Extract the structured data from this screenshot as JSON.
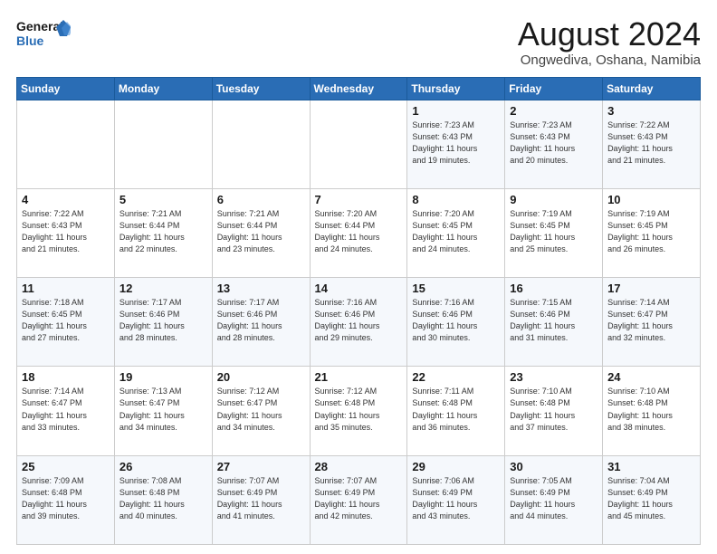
{
  "logo": {
    "line1": "General",
    "line2": "Blue"
  },
  "title": "August 2024",
  "subtitle": "Ongwediva, Oshana, Namibia",
  "weekdays": [
    "Sunday",
    "Monday",
    "Tuesday",
    "Wednesday",
    "Thursday",
    "Friday",
    "Saturday"
  ],
  "weeks": [
    [
      {
        "day": "",
        "info": ""
      },
      {
        "day": "",
        "info": ""
      },
      {
        "day": "",
        "info": ""
      },
      {
        "day": "",
        "info": ""
      },
      {
        "day": "1",
        "info": "Sunrise: 7:23 AM\nSunset: 6:43 PM\nDaylight: 11 hours\nand 19 minutes."
      },
      {
        "day": "2",
        "info": "Sunrise: 7:23 AM\nSunset: 6:43 PM\nDaylight: 11 hours\nand 20 minutes."
      },
      {
        "day": "3",
        "info": "Sunrise: 7:22 AM\nSunset: 6:43 PM\nDaylight: 11 hours\nand 21 minutes."
      }
    ],
    [
      {
        "day": "4",
        "info": "Sunrise: 7:22 AM\nSunset: 6:43 PM\nDaylight: 11 hours\nand 21 minutes."
      },
      {
        "day": "5",
        "info": "Sunrise: 7:21 AM\nSunset: 6:44 PM\nDaylight: 11 hours\nand 22 minutes."
      },
      {
        "day": "6",
        "info": "Sunrise: 7:21 AM\nSunset: 6:44 PM\nDaylight: 11 hours\nand 23 minutes."
      },
      {
        "day": "7",
        "info": "Sunrise: 7:20 AM\nSunset: 6:44 PM\nDaylight: 11 hours\nand 24 minutes."
      },
      {
        "day": "8",
        "info": "Sunrise: 7:20 AM\nSunset: 6:45 PM\nDaylight: 11 hours\nand 24 minutes."
      },
      {
        "day": "9",
        "info": "Sunrise: 7:19 AM\nSunset: 6:45 PM\nDaylight: 11 hours\nand 25 minutes."
      },
      {
        "day": "10",
        "info": "Sunrise: 7:19 AM\nSunset: 6:45 PM\nDaylight: 11 hours\nand 26 minutes."
      }
    ],
    [
      {
        "day": "11",
        "info": "Sunrise: 7:18 AM\nSunset: 6:45 PM\nDaylight: 11 hours\nand 27 minutes."
      },
      {
        "day": "12",
        "info": "Sunrise: 7:17 AM\nSunset: 6:46 PM\nDaylight: 11 hours\nand 28 minutes."
      },
      {
        "day": "13",
        "info": "Sunrise: 7:17 AM\nSunset: 6:46 PM\nDaylight: 11 hours\nand 28 minutes."
      },
      {
        "day": "14",
        "info": "Sunrise: 7:16 AM\nSunset: 6:46 PM\nDaylight: 11 hours\nand 29 minutes."
      },
      {
        "day": "15",
        "info": "Sunrise: 7:16 AM\nSunset: 6:46 PM\nDaylight: 11 hours\nand 30 minutes."
      },
      {
        "day": "16",
        "info": "Sunrise: 7:15 AM\nSunset: 6:46 PM\nDaylight: 11 hours\nand 31 minutes."
      },
      {
        "day": "17",
        "info": "Sunrise: 7:14 AM\nSunset: 6:47 PM\nDaylight: 11 hours\nand 32 minutes."
      }
    ],
    [
      {
        "day": "18",
        "info": "Sunrise: 7:14 AM\nSunset: 6:47 PM\nDaylight: 11 hours\nand 33 minutes."
      },
      {
        "day": "19",
        "info": "Sunrise: 7:13 AM\nSunset: 6:47 PM\nDaylight: 11 hours\nand 34 minutes."
      },
      {
        "day": "20",
        "info": "Sunrise: 7:12 AM\nSunset: 6:47 PM\nDaylight: 11 hours\nand 34 minutes."
      },
      {
        "day": "21",
        "info": "Sunrise: 7:12 AM\nSunset: 6:48 PM\nDaylight: 11 hours\nand 35 minutes."
      },
      {
        "day": "22",
        "info": "Sunrise: 7:11 AM\nSunset: 6:48 PM\nDaylight: 11 hours\nand 36 minutes."
      },
      {
        "day": "23",
        "info": "Sunrise: 7:10 AM\nSunset: 6:48 PM\nDaylight: 11 hours\nand 37 minutes."
      },
      {
        "day": "24",
        "info": "Sunrise: 7:10 AM\nSunset: 6:48 PM\nDaylight: 11 hours\nand 38 minutes."
      }
    ],
    [
      {
        "day": "25",
        "info": "Sunrise: 7:09 AM\nSunset: 6:48 PM\nDaylight: 11 hours\nand 39 minutes."
      },
      {
        "day": "26",
        "info": "Sunrise: 7:08 AM\nSunset: 6:48 PM\nDaylight: 11 hours\nand 40 minutes."
      },
      {
        "day": "27",
        "info": "Sunrise: 7:07 AM\nSunset: 6:49 PM\nDaylight: 11 hours\nand 41 minutes."
      },
      {
        "day": "28",
        "info": "Sunrise: 7:07 AM\nSunset: 6:49 PM\nDaylight: 11 hours\nand 42 minutes."
      },
      {
        "day": "29",
        "info": "Sunrise: 7:06 AM\nSunset: 6:49 PM\nDaylight: 11 hours\nand 43 minutes."
      },
      {
        "day": "30",
        "info": "Sunrise: 7:05 AM\nSunset: 6:49 PM\nDaylight: 11 hours\nand 44 minutes."
      },
      {
        "day": "31",
        "info": "Sunrise: 7:04 AM\nSunset: 6:49 PM\nDaylight: 11 hours\nand 45 minutes."
      }
    ]
  ]
}
